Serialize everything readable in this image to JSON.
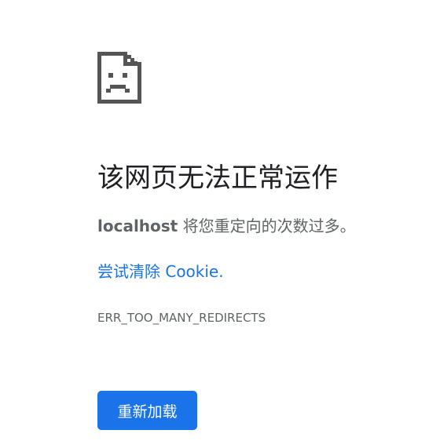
{
  "icon": {
    "name": "sad-page-icon",
    "color": "#555555"
  },
  "title": "该网页无法正常运作",
  "summary": {
    "host": "localhost",
    "message": " 将您重定向的次数过多。"
  },
  "suggestion": {
    "label": "尝试清除 Cookie."
  },
  "error_code": "ERR_TOO_MANY_REDIRECTS",
  "reload_button": {
    "label": "重新加载"
  },
  "colors": {
    "accent": "#1a73e8",
    "text_primary": "#202124",
    "text_secondary": "#5f6368",
    "background": "#ffffff"
  }
}
